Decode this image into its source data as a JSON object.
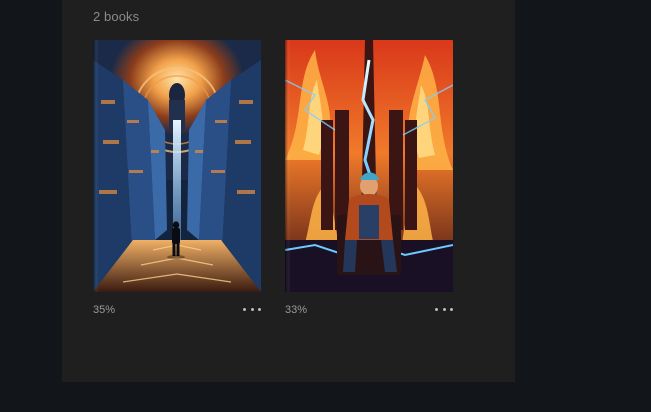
{
  "library": {
    "count_label": "2 books"
  },
  "books": [
    {
      "progress": "35%",
      "cover_icon": "cover-art-corridor",
      "more_icon": "more-horizontal-icon"
    },
    {
      "progress": "33%",
      "cover_icon": "cover-art-fire-throne",
      "more_icon": "more-horizontal-icon"
    }
  ],
  "colors": {
    "background": "#121519",
    "panel": "#1f1f1f",
    "muted_text": "#8a8a8a"
  }
}
